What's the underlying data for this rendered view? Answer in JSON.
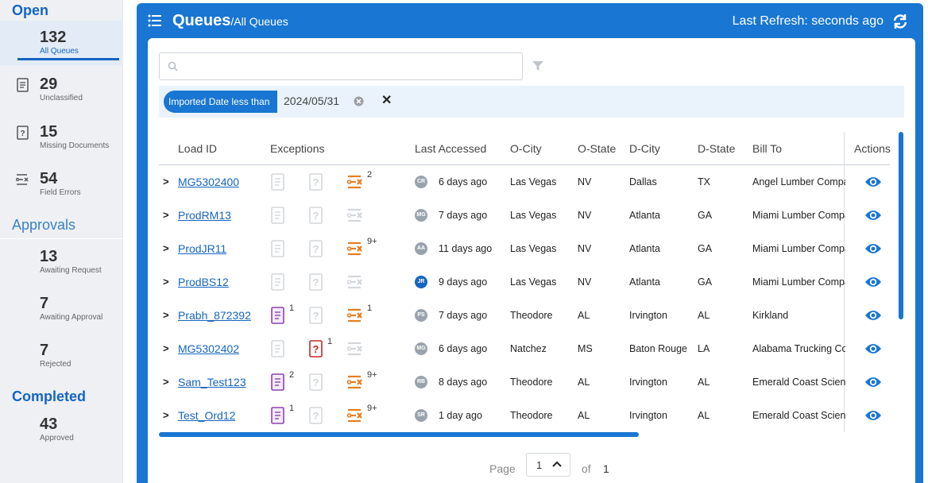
{
  "sidebar": {
    "open_heading": "Open",
    "approvals_heading": "Approvals",
    "completed_heading": "Completed",
    "items": [
      {
        "count": "132",
        "label": "All Queues",
        "icon": "none",
        "active": true
      },
      {
        "count": "29",
        "label": "Unclassified",
        "icon": "document-list-icon"
      },
      {
        "count": "15",
        "label": "Missing Documents",
        "icon": "missing-document-icon"
      },
      {
        "count": "54",
        "label": "Field Errors",
        "icon": "field-errors-icon"
      },
      {
        "count": "13",
        "label": "Awaiting Request"
      },
      {
        "count": "7",
        "label": "Awaiting Approval"
      },
      {
        "count": "7",
        "label": "Rejected"
      },
      {
        "count": "43",
        "label": "Approved"
      }
    ]
  },
  "header": {
    "title": "Queues",
    "subtitle": "/All Queues",
    "refresh_text": "Last Refresh: seconds ago"
  },
  "search": {
    "placeholder": "",
    "value": ""
  },
  "filter_chip": {
    "label": "Imported Date less than",
    "value": "2024/05/31"
  },
  "table": {
    "columns": [
      "Load ID",
      "Exceptions",
      "Last Accessed",
      "O-City",
      "O-State",
      "D-City",
      "D-State",
      "Bill To",
      "Actions"
    ],
    "rows": [
      {
        "load_id": "MG5302400",
        "unclassified": "",
        "missing": "",
        "field_errors": "2",
        "initials": "CR",
        "accessed": "6 days ago",
        "o_city": "Las Vegas",
        "o_state": "NV",
        "d_city": "Dallas",
        "d_state": "TX",
        "bill_to": "Angel Lumber Company"
      },
      {
        "load_id": "ProdRM13",
        "unclassified": "",
        "missing": "",
        "field_errors": "",
        "initials": "MG",
        "accessed": "7 days ago",
        "o_city": "Las Vegas",
        "o_state": "NV",
        "d_city": "Atlanta",
        "d_state": "GA",
        "bill_to": "Miami Lumber Company"
      },
      {
        "load_id": "ProdJR11",
        "unclassified": "",
        "missing": "",
        "field_errors": "9+",
        "initials": "AA",
        "accessed": "11 days ago",
        "o_city": "Las Vegas",
        "o_state": "NV",
        "d_city": "Atlanta",
        "d_state": "GA",
        "bill_to": "Miami Lumber Company"
      },
      {
        "load_id": "ProdBS12",
        "unclassified": "",
        "missing": "",
        "field_errors": "",
        "initials": "JR",
        "accessed": "9 days ago",
        "o_city": "Las Vegas",
        "o_state": "NV",
        "d_city": "Atlanta",
        "d_state": "GA",
        "bill_to": "Miami Lumber Company"
      },
      {
        "load_id": "Prabh_872392",
        "unclassified": "1",
        "missing": "",
        "field_errors": "1",
        "initials": "PS",
        "accessed": "7 days ago",
        "o_city": "Theodore",
        "o_state": "AL",
        "d_city": "Irvington",
        "d_state": "AL",
        "bill_to": "Kirkland"
      },
      {
        "load_id": "MG5302402",
        "unclassified": "",
        "missing": "1",
        "field_errors": "",
        "initials": "MG",
        "accessed": "6 days ago",
        "o_city": "Natchez",
        "o_state": "MS",
        "d_city": "Baton Rouge",
        "d_state": "LA",
        "bill_to": "Alabama Trucking Co"
      },
      {
        "load_id": "Sam_Test123",
        "unclassified": "2",
        "missing": "",
        "field_errors": "9+",
        "initials": "RB",
        "accessed": "8 days ago",
        "o_city": "Theodore",
        "o_state": "AL",
        "d_city": "Irvington",
        "d_state": "AL",
        "bill_to": "Emerald Coast Science"
      },
      {
        "load_id": "Test_Ord12",
        "unclassified": "1",
        "missing": "",
        "field_errors": "9+",
        "initials": "SR",
        "accessed": "1 day ago",
        "o_city": "Theodore",
        "o_state": "AL",
        "d_city": "Irvington",
        "d_state": "AL",
        "bill_to": "Emerald Coast Science"
      }
    ]
  },
  "pager": {
    "page_label": "Page",
    "current": "1",
    "of_label": "of",
    "total": "1"
  },
  "colors": {
    "accent": "#1976d2",
    "exception_purple": "#8e44ad",
    "exception_red": "#c62828",
    "exception_orange": "#e67e22"
  }
}
